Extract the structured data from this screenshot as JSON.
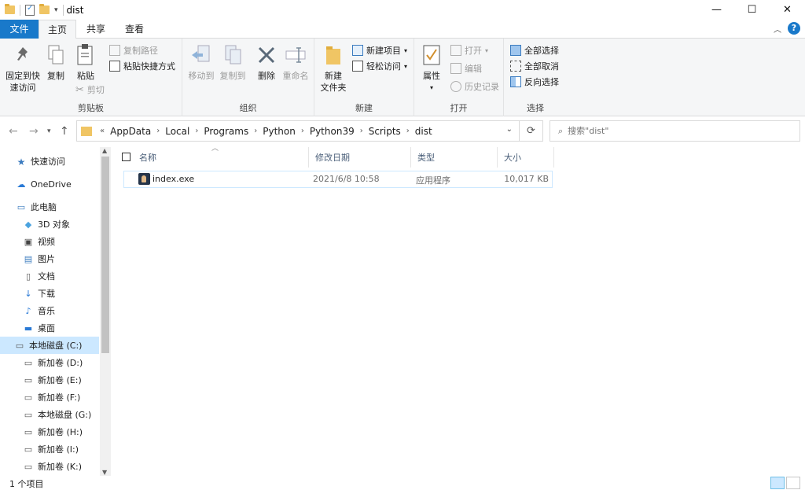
{
  "window": {
    "title": "dist",
    "minimize": "—",
    "maximize": "☐",
    "close": "✕"
  },
  "tabs": {
    "file": "文件",
    "home": "主页",
    "share": "共享",
    "view": "查看"
  },
  "ribbon": {
    "clipboard": {
      "label": "剪贴板",
      "pin": "固定到快\n速访问",
      "pin_line1": "固定到快",
      "pin_line2": "速访问",
      "copy": "复制",
      "paste": "粘贴",
      "copy_path": "复制路径",
      "paste_shortcut": "粘贴快捷方式",
      "cut": "剪切"
    },
    "organize": {
      "label": "组织",
      "move_to": "移动到",
      "copy_to": "复制到",
      "delete": "删除",
      "rename": "重命名"
    },
    "new": {
      "label": "新建",
      "new_folder_line1": "新建",
      "new_folder_line2": "文件夹",
      "new_item": "新建项目",
      "easy_access": "轻松访问"
    },
    "open": {
      "label": "打开",
      "properties": "属性",
      "open": "打开",
      "edit": "编辑",
      "history": "历史记录"
    },
    "select": {
      "label": "选择",
      "select_all": "全部选择",
      "select_none": "全部取消",
      "invert": "反向选择"
    }
  },
  "address": {
    "crumbs": [
      "AppData",
      "Local",
      "Programs",
      "Python",
      "Python39",
      "Scripts",
      "dist"
    ],
    "overflow": "«",
    "search_placeholder": "搜索\"dist\""
  },
  "nav": {
    "items": [
      {
        "label": "快速访问",
        "icon": "star-icon"
      },
      {
        "label": "OneDrive",
        "icon": "cloud-icon"
      },
      {
        "label": "此电脑",
        "icon": "computer-icon"
      },
      {
        "label": "3D 对象",
        "icon": "cube-icon"
      },
      {
        "label": "视频",
        "icon": "video-icon"
      },
      {
        "label": "图片",
        "icon": "picture-icon"
      },
      {
        "label": "文档",
        "icon": "document-icon"
      },
      {
        "label": "下载",
        "icon": "download-icon"
      },
      {
        "label": "音乐",
        "icon": "music-icon"
      },
      {
        "label": "桌面",
        "icon": "desktop-icon"
      },
      {
        "label": "本地磁盘 (C:)",
        "icon": "drive-icon",
        "selected": true
      },
      {
        "label": "新加卷 (D:)",
        "icon": "drive-icon"
      },
      {
        "label": "新加卷 (E:)",
        "icon": "drive-icon"
      },
      {
        "label": "新加卷 (F:)",
        "icon": "drive-icon"
      },
      {
        "label": "本地磁盘 (G:)",
        "icon": "drive-icon"
      },
      {
        "label": "新加卷 (H:)",
        "icon": "drive-icon"
      },
      {
        "label": "新加卷 (I:)",
        "icon": "drive-icon"
      },
      {
        "label": "新加卷 (K:)",
        "icon": "network-drive-icon"
      }
    ]
  },
  "columns": {
    "name": "名称",
    "modified": "修改日期",
    "type": "类型",
    "size": "大小"
  },
  "files": [
    {
      "name": "index.exe",
      "modified": "2021/6/8 10:58",
      "type": "应用程序",
      "size": "10,017 KB"
    }
  ],
  "status": {
    "count": "1 个项目"
  },
  "colors": {
    "accent": "#1979ca",
    "selection": "#cce8ff",
    "folder": "#f0c564"
  }
}
